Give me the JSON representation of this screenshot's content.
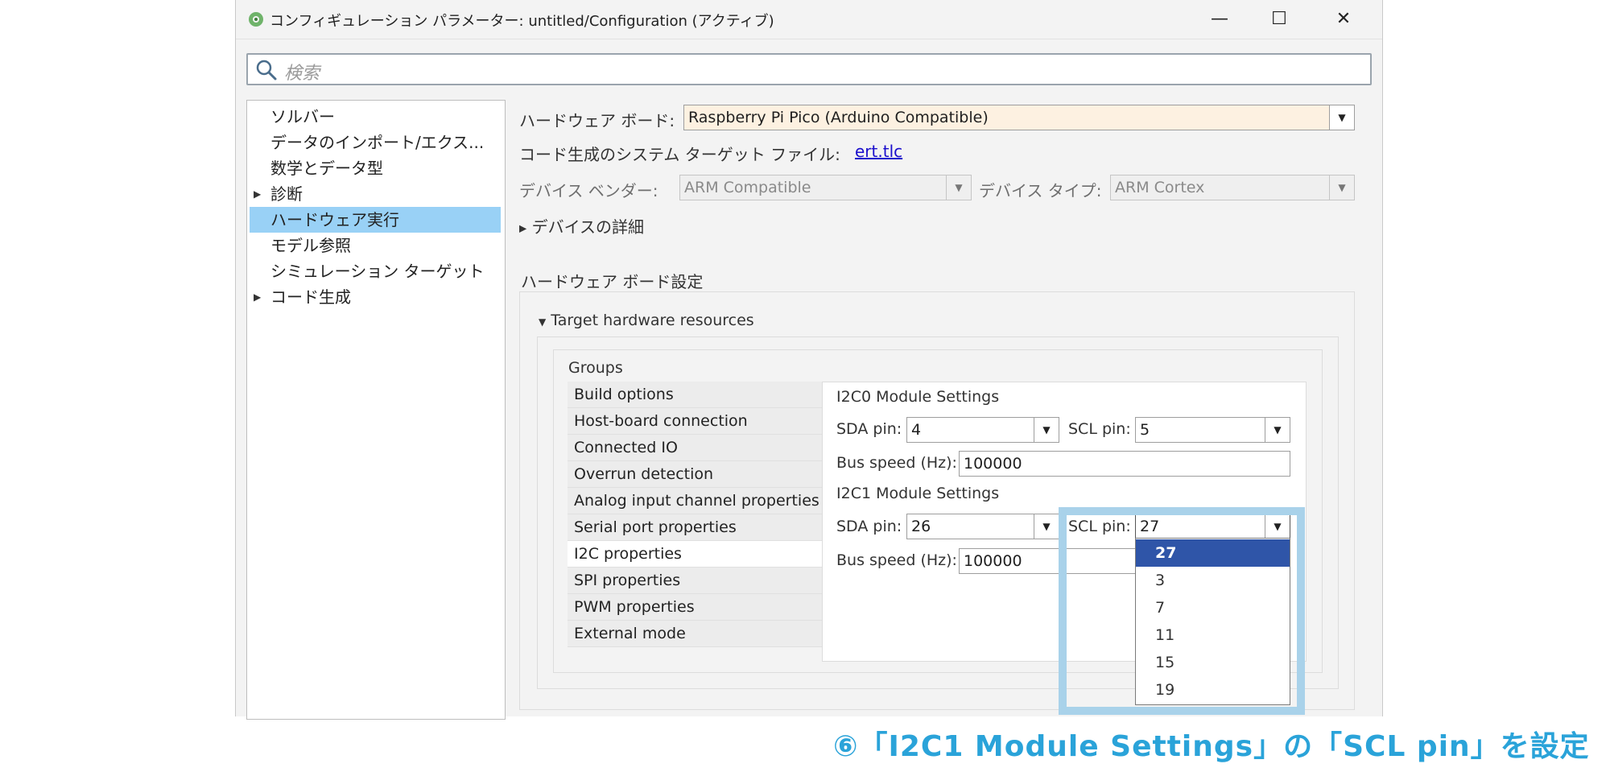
{
  "window": {
    "title": "コンフィギュレーション パラメーター: untitled/Configuration (アクティブ)",
    "controls": {
      "minimize": "—",
      "maximize": "☐",
      "close": "✕"
    }
  },
  "search": {
    "placeholder": "検索"
  },
  "tree": {
    "items": [
      {
        "label": "ソルバー",
        "expandable": false
      },
      {
        "label": "データのインポート/エクス...",
        "expandable": false
      },
      {
        "label": "数学とデータ型",
        "expandable": false
      },
      {
        "label": "診断",
        "expandable": true
      },
      {
        "label": "ハードウェア実行",
        "expandable": false,
        "selected": true
      },
      {
        "label": "モデル参照",
        "expandable": false
      },
      {
        "label": "シミュレーション ターゲット",
        "expandable": false
      },
      {
        "label": "コード生成",
        "expandable": true
      }
    ],
    "arrow": "▶"
  },
  "hardware": {
    "board_label": "ハードウェア ボード:",
    "board_value": "Raspberry Pi Pico (Arduino Compatible)",
    "system_target_label": "コード生成のシステム ターゲット ファイル:",
    "system_target_link": "ert.tlc",
    "vendor_label": "デバイス ベンダー:",
    "vendor_value": "ARM Compatible",
    "type_label": "デバイス タイプ:",
    "type_value": "ARM Cortex",
    "device_details": "デバイスの詳細",
    "board_settings_title": "ハードウェア ボード設定",
    "target_resources": "Target hardware resources",
    "groups_label": "Groups"
  },
  "groups": [
    "Build options",
    "Host-board connection",
    "Connected IO",
    "Overrun detection",
    "Analog input channel properties",
    "Serial port properties",
    "I2C properties",
    "SPI properties",
    "PWM properties",
    "External mode"
  ],
  "i2c0": {
    "title": "I2C0 Module Settings",
    "sda_label": "SDA pin:",
    "sda_value": "4",
    "scl_label": "SCL pin:",
    "scl_value": "5",
    "bus_label": "Bus speed (Hz):",
    "bus_value": "100000"
  },
  "i2c1": {
    "title": "I2C1 Module Settings",
    "sda_label": "SDA pin:",
    "sda_value": "26",
    "scl_label": "SCL pin:",
    "scl_value": "27",
    "bus_label": "Bus speed (Hz):",
    "bus_value": "100000"
  },
  "scl_dropdown_options": [
    "27",
    "3",
    "7",
    "11",
    "15",
    "19"
  ],
  "caption": "⑥「I2C1 Module Settings」の「SCL pin」を設定",
  "colors": {
    "selection": "#99d1f6",
    "dropdown_selected": "#2f55a8",
    "highlight_frame": "#a9d2ea",
    "caption": "#2aa3d9",
    "board_field_bg": "#fdf1e1"
  }
}
